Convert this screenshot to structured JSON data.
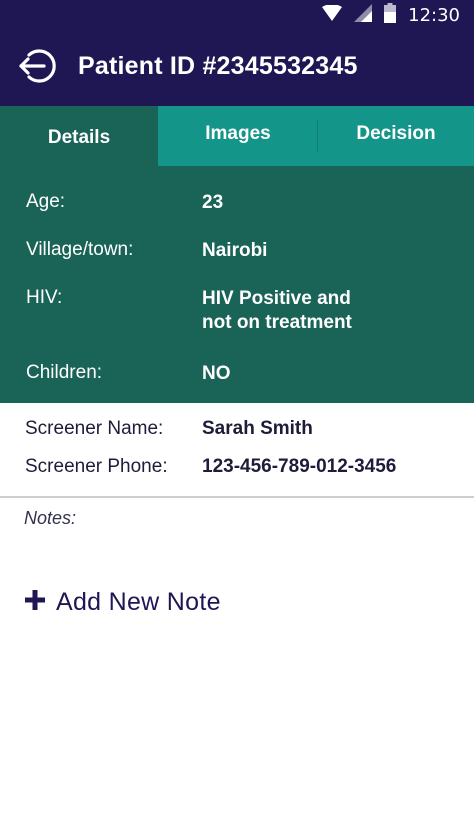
{
  "status_bar": {
    "time": "12:30",
    "icons": [
      "wifi-icon",
      "signal-icon",
      "battery-icon"
    ]
  },
  "app_bar": {
    "title": "Patient ID #2345532345",
    "back_icon": "logout-arrow-icon"
  },
  "tabs": [
    {
      "label": "Details",
      "active": true
    },
    {
      "label": "Images",
      "active": false
    },
    {
      "label": "Decision",
      "active": false
    }
  ],
  "details": [
    {
      "label": "Age:",
      "value": "23"
    },
    {
      "label": "Village/town:",
      "value": "Nairobi"
    },
    {
      "label": "HIV:",
      "value": "HIV Positive and\nnot on treatment"
    },
    {
      "label": "Children:",
      "value": "NO"
    }
  ],
  "screener": [
    {
      "label": "Screener Name:",
      "value": "Sarah Smith"
    },
    {
      "label": "Screener Phone:",
      "value": "123-456-789-012-3456"
    }
  ],
  "notes": {
    "label": "Notes:",
    "add_label": "Add New Note",
    "add_icon": "plus-icon"
  },
  "colors": {
    "primary": "#1e1753",
    "tab_bar": "#14958a",
    "details_bg": "#1a6357"
  }
}
